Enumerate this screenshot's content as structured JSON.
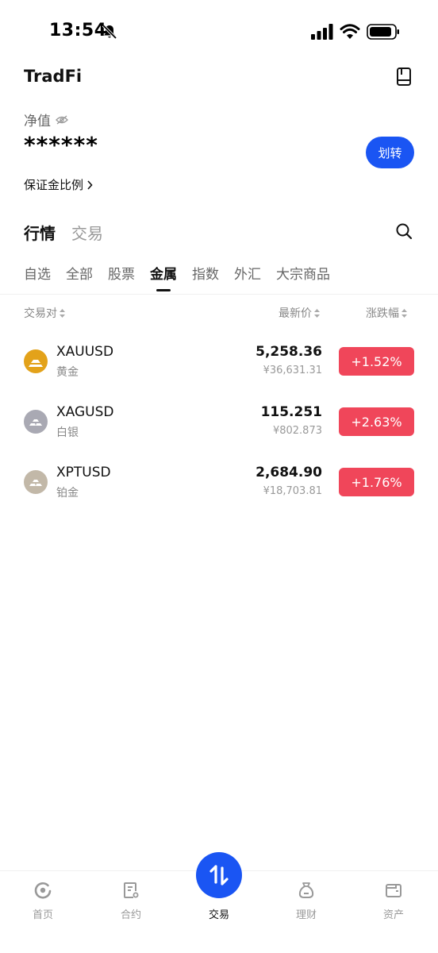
{
  "status_bar": {
    "time": "13:54"
  },
  "header": {
    "title": "TradFi"
  },
  "account": {
    "net_value_label": "净值",
    "net_value": "******",
    "transfer_label": "划转",
    "margin_ratio_label": "保证金比例"
  },
  "main_tabs": [
    {
      "label": "行情",
      "active": true
    },
    {
      "label": "交易",
      "active": false
    }
  ],
  "category_tabs": [
    {
      "label": "自选",
      "active": false
    },
    {
      "label": "全部",
      "active": false
    },
    {
      "label": "股票",
      "active": false
    },
    {
      "label": "金属",
      "active": true
    },
    {
      "label": "指数",
      "active": false
    },
    {
      "label": "外汇",
      "active": false
    },
    {
      "label": "大宗商品",
      "active": false
    }
  ],
  "columns": {
    "pair": "交易对",
    "price": "最新价",
    "change": "涨跌幅"
  },
  "rows": [
    {
      "symbol": "XAUUSD",
      "name": "黄金",
      "price": "5,258.36",
      "price_cny": "¥36,631.31",
      "change": "+1.52%",
      "icon": "gold-bar-icon",
      "icon_color": "#e3a21a"
    },
    {
      "symbol": "XAGUSD",
      "name": "白银",
      "price": "115.251",
      "price_cny": "¥802.873",
      "change": "+2.63%",
      "icon": "silver-bar-icon",
      "icon_color": "#a9a9b3"
    },
    {
      "symbol": "XPTUSD",
      "name": "铂金",
      "price": "2,684.90",
      "price_cny": "¥18,703.81",
      "change": "+1.76%",
      "icon": "platinum-bar-icon",
      "icon_color": "#c2b8a8"
    }
  ],
  "bottom_nav": [
    {
      "label": "首页",
      "icon": "home-icon"
    },
    {
      "label": "合约",
      "icon": "contract-icon"
    },
    {
      "label": "交易",
      "icon": "trade-icon"
    },
    {
      "label": "理财",
      "icon": "finance-icon"
    },
    {
      "label": "资产",
      "icon": "wallet-icon"
    }
  ],
  "colors": {
    "accent": "#1a55f3",
    "up": "#f0465a"
  }
}
